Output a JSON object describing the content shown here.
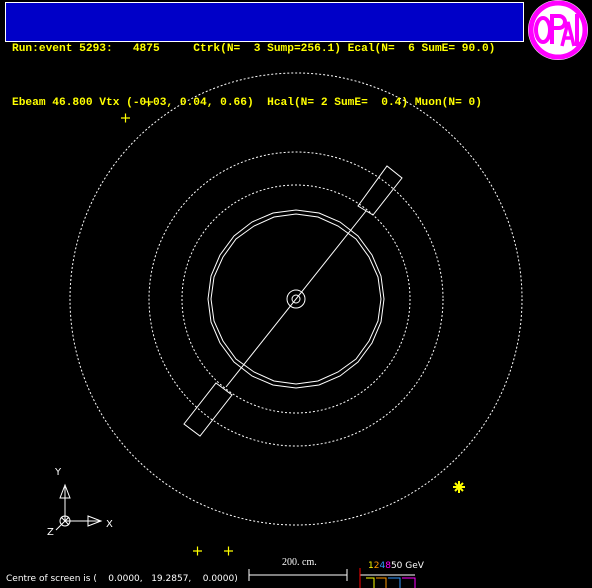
{
  "header": {
    "line1": "Run:event 5293:   4875     Ctrk(N=  3 Sump=256.1) Ecal(N=  6 SumE= 90.0)",
    "line2": "Ebeam 46.800 Vtx (-0.03, 0.04, 0.66)  Hcal(N= 2 SumE=  0.4) Muon(N= 0)"
  },
  "logo": {
    "text": "OPAL",
    "ring_color": "#ff00ff"
  },
  "axes": {
    "y": "Y",
    "x": "X",
    "z": "Z"
  },
  "scale": {
    "label": "200. cm."
  },
  "energy_legend": {
    "digits": [
      {
        "text": "1",
        "color": "#ffff00"
      },
      {
        "text": "2",
        "color": "#ff9900"
      },
      {
        "text": "4",
        "color": "#3399ff"
      },
      {
        "text": "8",
        "color": "#ff00ff"
      },
      {
        "text": "50 GeV",
        "color": "#ffffff"
      }
    ]
  },
  "footer": {
    "centre": "Centre of screen is (    0.0000,   19.2857,    0.0000)"
  },
  "colors": {
    "header_bg": "#0000c8",
    "header_text": "#ffff00",
    "marker_yellow": "#ffff00"
  }
}
